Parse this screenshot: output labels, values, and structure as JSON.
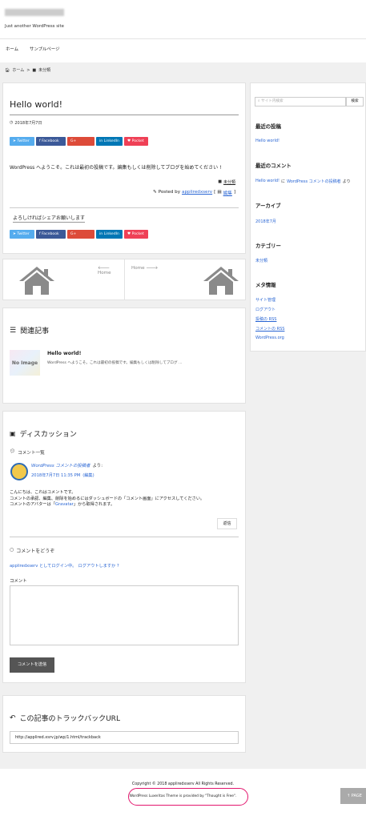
{
  "site": {
    "tagline": "Just another WordPress site"
  },
  "nav": {
    "items": [
      "ホーム",
      "サンプルページ"
    ]
  },
  "breadcrumb": {
    "home": "ホーム",
    "sep": ">",
    "category": "未分類"
  },
  "post": {
    "title": "Hello world!",
    "date": "2018年7月7日",
    "share": {
      "twitter": "Twitter",
      "facebook": "Facebook",
      "google": "Google+",
      "linkedin": "LinkedIn",
      "pocket": "Pocket"
    },
    "body": "WordPress へようこそ。これは最初の投稿です。編集もしくは削除してブログを始めてください !",
    "category": "未分類",
    "posted_by_prefix": "Posted by",
    "author": "appliredxserv",
    "edit_open": "[",
    "edit": "編集",
    "edit_close": "]",
    "share_prompt": "よろしければシェアお願いします"
  },
  "pager": {
    "prev": "Home",
    "next": "Home"
  },
  "related": {
    "title": "関連記事",
    "item_title": "Hello world!",
    "item_excerpt": "WordPress へようこそ。これは最初の投稿です。編集もしくは削除してブログ ...",
    "noimage": "No Image"
  },
  "discussion": {
    "title": "ディスカッション",
    "list_title": "コメント一覧",
    "comment_author": "WordPress コメントの投稿者",
    "comment_says": "より:",
    "comment_date": "2018年7月7日 11:35 PM",
    "comment_edit": "(編集)",
    "comment_lines": [
      "こんにちは、これはコメントです。",
      "コメントの承認、編集、削除を始めるにはダッシュボードの「コメント画面」にアクセスしてください。"
    ],
    "avatar_line_pre": "コメントのアバターは「",
    "avatar_link": "Gravatar",
    "avatar_line_post": "」から取得されます。",
    "reply": "返信",
    "form_title": "コメントをどうぞ",
    "logged_in_user": "appliredxserv としてログイン中。",
    "logout": "ログアウトしますか ?",
    "comment_label": "コメント",
    "submit": "コメントを送信"
  },
  "trackback": {
    "title": "この記事のトラックバックURL",
    "url": "http://applired.xsrv.jp/wp/1.html/trackback"
  },
  "sidebar": {
    "search_placeholder": "サイト内検索",
    "search_button": "検索",
    "recent_posts_title": "最近の投稿",
    "recent_posts": [
      "Hello world!"
    ],
    "recent_comments_title": "最近のコメント",
    "rc_post": "Hello world!",
    "rc_on": "に",
    "rc_author": "WordPress コメントの投稿者",
    "rc_suffix": "より",
    "archive_title": "アーカイブ",
    "archives": [
      "2018年7月"
    ],
    "category_title": "カテゴリー",
    "categories": [
      "未分類"
    ],
    "meta_title": "メタ情報",
    "meta": [
      "サイト管理",
      "ログアウト",
      "投稿の RSS",
      "コメントの RSS",
      "WordPress.org"
    ]
  },
  "footer": {
    "copyright": "Copyright © 2018 appliredxserv All Rights Reserved.",
    "credit": "WordPress Luxeritas Theme is provided by \"Thought is Free\".",
    "pagetop": "PAGE"
  },
  "colors": {
    "link": "#2a66d4",
    "circle": "#e3166e",
    "twitter": "#55acee",
    "facebook": "#3b5998",
    "google": "#dd4b39",
    "linkedin": "#0077b5",
    "pocket": "#ef4056"
  }
}
